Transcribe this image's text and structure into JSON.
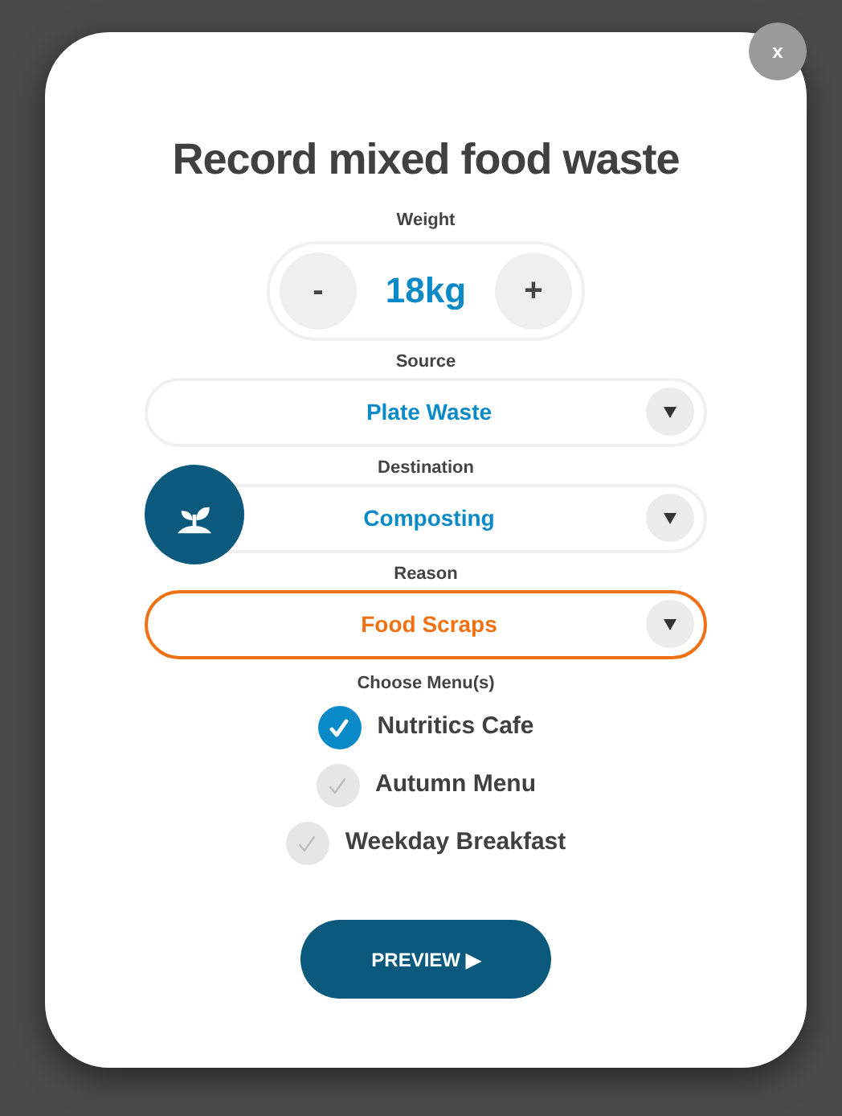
{
  "dialog": {
    "close": "x",
    "title": "Record mixed food waste",
    "weight": {
      "label": "Weight",
      "decrement": "-",
      "value": "18kg",
      "increment": "+"
    },
    "selects": [
      {
        "label": "Source",
        "value": "Plate Waste",
        "focused": false,
        "has_icon": false
      },
      {
        "label": "Destination",
        "value": "Composting",
        "focused": false,
        "has_icon": true
      },
      {
        "label": "Reason",
        "value": "Food Scraps",
        "focused": true,
        "has_icon": false
      }
    ],
    "menus_label": "Choose Menu(s)",
    "menus": [
      {
        "name": "Nutritics Cafe",
        "checked": true
      },
      {
        "name": "Autumn Menu",
        "checked": false
      },
      {
        "name": "Weekday Breakfast",
        "checked": false
      }
    ],
    "preview": "PREVIEW ▶"
  }
}
